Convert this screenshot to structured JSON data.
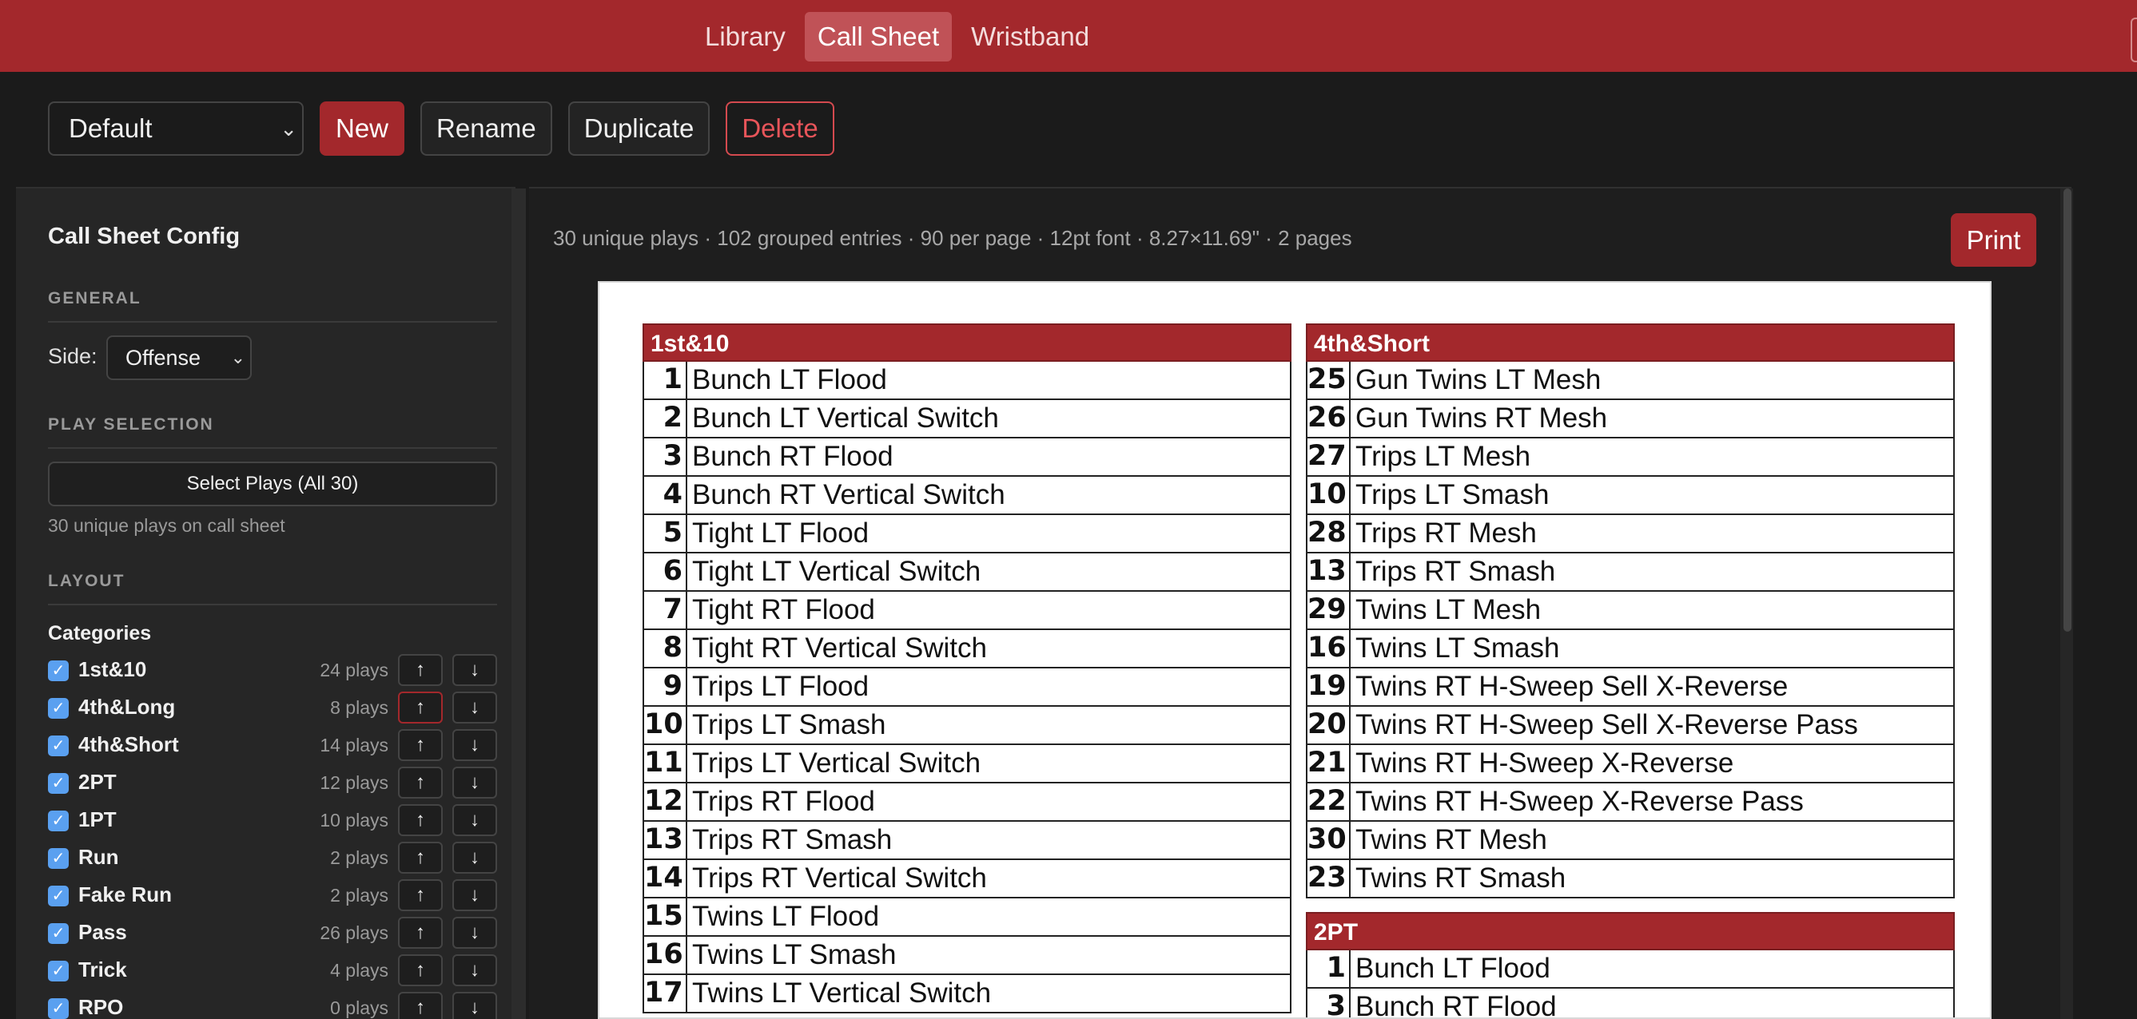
{
  "nav": {
    "tabs": [
      {
        "label": "Library",
        "active": false
      },
      {
        "label": "Call Sheet",
        "active": true
      },
      {
        "label": "Wristband",
        "active": false
      }
    ]
  },
  "toolbar": {
    "sheet_select_value": "Default",
    "new_label": "New",
    "rename_label": "Rename",
    "duplicate_label": "Duplicate",
    "delete_label": "Delete"
  },
  "sidebar": {
    "title": "Call Sheet Config",
    "general_heading": "GENERAL",
    "side_label": "Side:",
    "side_value": "Offense",
    "play_selection_heading": "PLAY SELECTION",
    "select_plays_label": "Select Plays (All 30)",
    "unique_plays_text": "30 unique plays on call sheet",
    "layout_heading": "LAYOUT",
    "categories_title": "Categories",
    "categories": [
      {
        "name": "1st&10",
        "count": "24 plays",
        "checked": true
      },
      {
        "name": "4th&Long",
        "count": "8 plays",
        "checked": true
      },
      {
        "name": "4th&Short",
        "count": "14 plays",
        "checked": true
      },
      {
        "name": "2PT",
        "count": "12 plays",
        "checked": true
      },
      {
        "name": "1PT",
        "count": "10 plays",
        "checked": true
      },
      {
        "name": "Run",
        "count": "2 plays",
        "checked": true
      },
      {
        "name": "Fake Run",
        "count": "2 plays",
        "checked": true
      },
      {
        "name": "Pass",
        "count": "26 plays",
        "checked": true
      },
      {
        "name": "Trick",
        "count": "4 plays",
        "checked": true
      },
      {
        "name": "RPO",
        "count": "0 plays",
        "checked": true
      }
    ],
    "up_glyph": "↑",
    "down_glyph": "↓",
    "check_glyph": "✓"
  },
  "main": {
    "summary": "30 unique plays · 102 grouped entries · 90 per page · 12pt font · 8.27×11.69\" · 2 pages",
    "print_label": "Print"
  },
  "sheet": {
    "sections": [
      {
        "title": "1st&10",
        "rows": [
          {
            "num": "1",
            "name": "Bunch LT Flood"
          },
          {
            "num": "2",
            "name": "Bunch LT Vertical Switch"
          },
          {
            "num": "3",
            "name": "Bunch RT Flood"
          },
          {
            "num": "4",
            "name": "Bunch RT Vertical Switch"
          },
          {
            "num": "5",
            "name": "Tight LT Flood"
          },
          {
            "num": "6",
            "name": "Tight LT Vertical Switch"
          },
          {
            "num": "7",
            "name": "Tight RT Flood"
          },
          {
            "num": "8",
            "name": "Tight RT Vertical Switch"
          },
          {
            "num": "9",
            "name": "Trips LT Flood"
          },
          {
            "num": "10",
            "name": "Trips LT Smash"
          },
          {
            "num": "11",
            "name": "Trips LT Vertical Switch"
          },
          {
            "num": "12",
            "name": "Trips RT Flood"
          },
          {
            "num": "13",
            "name": "Trips RT Smash"
          },
          {
            "num": "14",
            "name": "Trips RT Vertical Switch"
          },
          {
            "num": "15",
            "name": "Twins LT Flood"
          },
          {
            "num": "16",
            "name": "Twins LT Smash"
          },
          {
            "num": "17",
            "name": "Twins LT Vertical Switch"
          }
        ]
      },
      {
        "title": "4th&Short",
        "rows": [
          {
            "num": "25",
            "name": "Gun Twins LT Mesh"
          },
          {
            "num": "26",
            "name": "Gun Twins RT Mesh"
          },
          {
            "num": "27",
            "name": "Trips LT Mesh"
          },
          {
            "num": "10",
            "name": "Trips LT Smash"
          },
          {
            "num": "28",
            "name": "Trips RT Mesh"
          },
          {
            "num": "13",
            "name": "Trips RT Smash"
          },
          {
            "num": "29",
            "name": "Twins LT Mesh"
          },
          {
            "num": "16",
            "name": "Twins LT Smash"
          },
          {
            "num": "19",
            "name": "Twins RT H-Sweep Sell X-Reverse"
          },
          {
            "num": "20",
            "name": "Twins RT H-Sweep Sell X-Reverse Pass"
          },
          {
            "num": "21",
            "name": "Twins RT H-Sweep X-Reverse"
          },
          {
            "num": "22",
            "name": "Twins RT H-Sweep X-Reverse Pass"
          },
          {
            "num": "30",
            "name": "Twins RT Mesh"
          },
          {
            "num": "23",
            "name": "Twins RT Smash"
          }
        ]
      },
      {
        "title": "2PT",
        "rows": [
          {
            "num": "1",
            "name": "Bunch LT Flood"
          },
          {
            "num": "3",
            "name": "Bunch RT Flood"
          }
        ]
      }
    ]
  },
  "colors": {
    "brand": "#a3282c",
    "check": "#5aa0f0"
  }
}
